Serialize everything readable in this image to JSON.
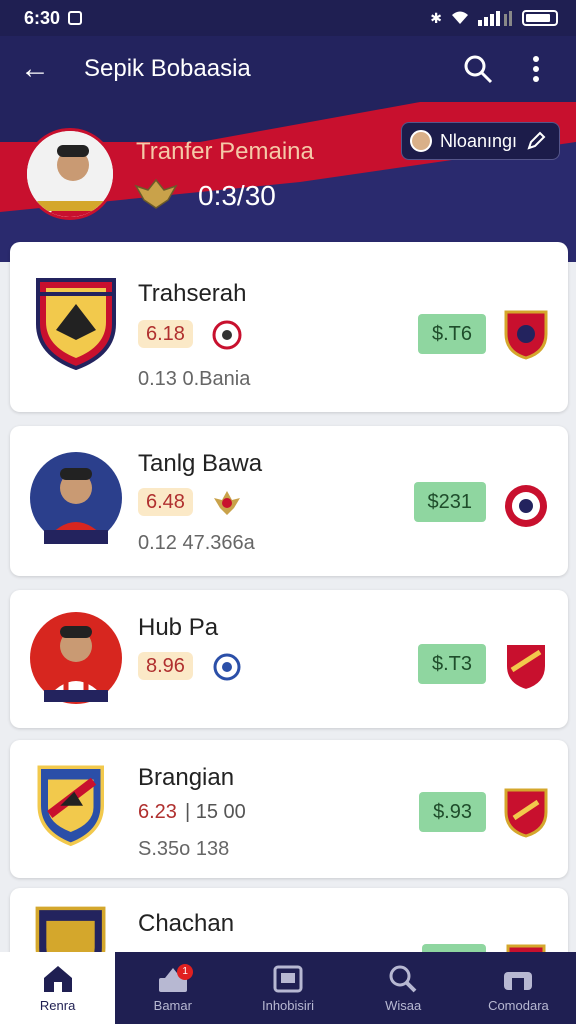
{
  "status_bar": {
    "time": "6:30"
  },
  "app_bar": {
    "title": "Sepik Bobaasia"
  },
  "hero": {
    "title": "Tranfer Pemaina",
    "score": "0:3/30",
    "chip_label": "Nloanıngı"
  },
  "players": [
    {
      "name": "Trahserah",
      "rating": "6.18",
      "sub": "0.13 0.Bania",
      "price": "$.T6",
      "logo_type": "crest-red"
    },
    {
      "name": "Tanlg Bawa",
      "rating": "6.48",
      "sub": "0.12 47.366a",
      "price": "$231",
      "logo_type": "player-blue"
    },
    {
      "name": "Hub Pa",
      "rating": "8.96",
      "sub": "",
      "price": "$.T3",
      "logo_type": "player-red"
    },
    {
      "name": "Brangian",
      "rating": "6.23",
      "rating_extra": "| 15 00",
      "sub": "S.35o 138",
      "price": "$.93",
      "logo_type": "crest-blue"
    },
    {
      "name": "Chachan",
      "rating": "",
      "sub": "",
      "price": "",
      "logo_type": "crest-gold"
    }
  ],
  "bottom_nav": [
    {
      "label": "Renra",
      "icon": "home-icon",
      "active": true
    },
    {
      "label": "Bamar",
      "icon": "market-icon",
      "badge": "1"
    },
    {
      "label": "Inhobisiri",
      "icon": "inbox-icon"
    },
    {
      "label": "Wisaa",
      "icon": "search-icon"
    },
    {
      "label": "Comodara",
      "icon": "stadium-icon"
    }
  ],
  "colors": {
    "primary": "#23235e",
    "accent_red": "#c8102e",
    "price_green": "#8fd6a0",
    "rating_bg": "#fbe9c7"
  }
}
